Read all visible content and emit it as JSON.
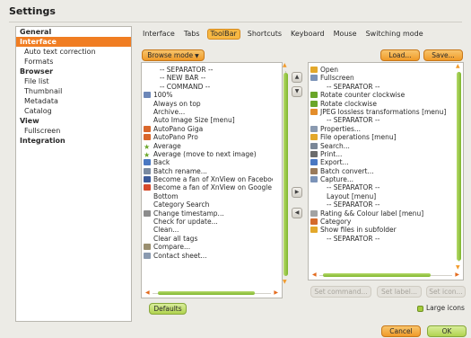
{
  "window": {
    "title": "Settings"
  },
  "categories": [
    {
      "label": "General",
      "kind": "group",
      "selected": false
    },
    {
      "label": "Interface",
      "kind": "group",
      "selected": true
    },
    {
      "label": "Auto text correction",
      "kind": "sub",
      "selected": false
    },
    {
      "label": "Formats",
      "kind": "sub",
      "selected": false
    },
    {
      "label": "Browser",
      "kind": "group",
      "selected": false
    },
    {
      "label": "File list",
      "kind": "sub",
      "selected": false
    },
    {
      "label": "Thumbnail",
      "kind": "sub",
      "selected": false
    },
    {
      "label": "Metadata",
      "kind": "sub",
      "selected": false
    },
    {
      "label": "Catalog",
      "kind": "sub",
      "selected": false
    },
    {
      "label": "View",
      "kind": "group",
      "selected": false
    },
    {
      "label": "Fullscreen",
      "kind": "sub",
      "selected": false
    },
    {
      "label": "Integration",
      "kind": "group",
      "selected": false
    }
  ],
  "tabs": [
    {
      "label": "Interface",
      "active": false
    },
    {
      "label": "Tabs",
      "active": false
    },
    {
      "label": "ToolBar",
      "active": true
    },
    {
      "label": "Shortcuts",
      "active": false
    },
    {
      "label": "Keyboard",
      "active": false
    },
    {
      "label": "Mouse",
      "active": false
    },
    {
      "label": "Switching mode",
      "active": false
    }
  ],
  "toolbar_editor": {
    "mode_select": {
      "value": "Browse mode"
    },
    "load_label": "Load...",
    "save_label": "Save...",
    "available_commands": [
      {
        "label": "-- SEPARATOR --",
        "icon": "none",
        "sep": true
      },
      {
        "label": "-- NEW BAR --",
        "icon": "none",
        "sep": true
      },
      {
        "label": "-- COMMAND --",
        "icon": "none",
        "sep": true
      },
      {
        "label": "100%",
        "icon": "zoom-icon"
      },
      {
        "label": "Always on top",
        "icon": "none"
      },
      {
        "label": "Archive...",
        "icon": "none"
      },
      {
        "label": "Auto Image Size [menu]",
        "icon": "none"
      },
      {
        "label": "AutoPano Giga",
        "icon": "autopano-icon"
      },
      {
        "label": "AutoPano Pro",
        "icon": "autopano-icon"
      },
      {
        "label": "Average",
        "icon": "star-icon"
      },
      {
        "label": "Average (move to next image)",
        "icon": "star-icon"
      },
      {
        "label": "Back",
        "icon": "back-arrow-icon"
      },
      {
        "label": "Batch rename...",
        "icon": "rename-icon"
      },
      {
        "label": "Become a fan of XnView on Facebook",
        "icon": "facebook-icon"
      },
      {
        "label": "Become a fan of XnView on Google",
        "icon": "google-icon"
      },
      {
        "label": "Bottom",
        "icon": "none"
      },
      {
        "label": "Category Search",
        "icon": "none"
      },
      {
        "label": "Change timestamp...",
        "icon": "timestamp-icon"
      },
      {
        "label": "Check for update...",
        "icon": "none"
      },
      {
        "label": "Clean...",
        "icon": "none"
      },
      {
        "label": "Clear all tags",
        "icon": "none"
      },
      {
        "label": "Compare...",
        "icon": "compare-icon"
      },
      {
        "label": "Contact sheet...",
        "icon": "contact-sheet-icon"
      }
    ],
    "toolbar_items": [
      {
        "label": "Open",
        "icon": "folder-icon"
      },
      {
        "label": "Fullscreen",
        "icon": "fullscreen-icon"
      },
      {
        "label": "-- SEPARATOR --",
        "icon": "none",
        "sep": true
      },
      {
        "label": "Rotate counter clockwise",
        "icon": "rotate-ccw-icon"
      },
      {
        "label": "Rotate clockwise",
        "icon": "rotate-cw-icon"
      },
      {
        "label": "JPEG lossless transformations [menu]",
        "icon": "jpeg-icon"
      },
      {
        "label": "-- SEPARATOR --",
        "icon": "none",
        "sep": true
      },
      {
        "label": "Properties...",
        "icon": "properties-icon"
      },
      {
        "label": "File operations [menu]",
        "icon": "file-ops-icon"
      },
      {
        "label": "Search...",
        "icon": "search-icon"
      },
      {
        "label": "Print...",
        "icon": "print-icon"
      },
      {
        "label": "Export...",
        "icon": "export-icon"
      },
      {
        "label": "Batch convert...",
        "icon": "batch-convert-icon"
      },
      {
        "label": "Capture...",
        "icon": "capture-icon"
      },
      {
        "label": "-- SEPARATOR --",
        "icon": "none",
        "sep": true
      },
      {
        "label": "Layout [menu]",
        "icon": "none",
        "indent": true
      },
      {
        "label": "-- SEPARATOR --",
        "icon": "none",
        "sep": true
      },
      {
        "label": "Rating && Colour label [menu]",
        "icon": "rating-icon"
      },
      {
        "label": "Category",
        "icon": "category-icon"
      },
      {
        "label": "Show files in subfolder",
        "icon": "subfolder-icon"
      },
      {
        "label": "-- SEPARATOR --",
        "icon": "none",
        "sep": true
      }
    ],
    "set_command_label": "Set command...",
    "set_label_label": "Set label...",
    "set_icon_label": "Set icon...",
    "defaults_label": "Defaults",
    "large_icons_label": "Large icons",
    "large_icons_checked": true
  },
  "footer": {
    "cancel_label": "Cancel",
    "ok_label": "OK"
  },
  "icon_colors": {
    "zoom-icon": "#6c87b8",
    "autopano-icon": "#d9672b",
    "star-icon": "#6aa629",
    "back-arrow-icon": "#4a78c2",
    "rename-icon": "#7a8aa0",
    "facebook-icon": "#3b5998",
    "google-icon": "#d64a2b",
    "timestamp-icon": "#8c8c8c",
    "compare-icon": "#9a8f70",
    "contact-sheet-icon": "#8a9ab0",
    "folder-icon": "#e3a82b",
    "fullscreen-icon": "#7b93b8",
    "rotate-ccw-icon": "#6aa629",
    "rotate-cw-icon": "#6aa629",
    "jpeg-icon": "#e38d2b",
    "properties-icon": "#8a9ab0",
    "file-ops-icon": "#e3a82b",
    "search-icon": "#7b8797",
    "print-icon": "#6c6c6c",
    "export-icon": "#4a78c2",
    "batch-convert-icon": "#9a7a5a",
    "capture-icon": "#7b93b8",
    "rating-icon": "#a2a2a2",
    "category-icon": "#d46a2b",
    "subfolder-icon": "#e3a82b"
  }
}
